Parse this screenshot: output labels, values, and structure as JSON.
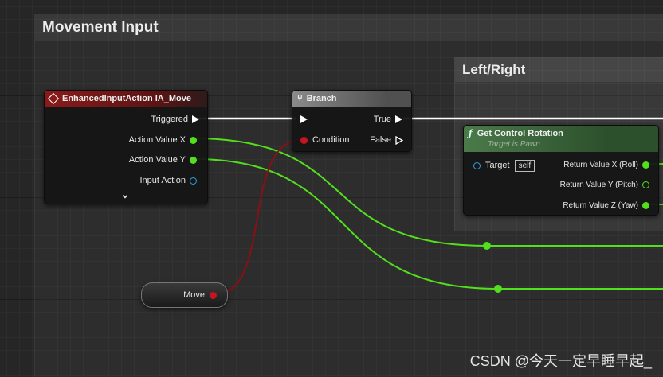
{
  "comments": {
    "movement_input": "Movement Input",
    "left_right": "Left/Right"
  },
  "nodes": {
    "enhanced_input": {
      "title": "EnhancedInputAction IA_Move",
      "pins": {
        "triggered": "Triggered",
        "action_value_x": "Action Value X",
        "action_value_y": "Action Value Y",
        "input_action": "Input Action"
      },
      "expand": "⌄"
    },
    "branch": {
      "title": "Branch",
      "pins": {
        "condition": "Condition",
        "true_label": "True",
        "false_label": "False"
      }
    },
    "get_control_rotation": {
      "title": "Get Control Rotation",
      "subtitle": "Target is Pawn",
      "target_label": "Target",
      "target_value": "self",
      "pins": {
        "roll": "Return Value X (Roll)",
        "pitch": "Return Value Y (Pitch)",
        "yaw": "Return Value Z (Yaw)"
      }
    },
    "move_var": {
      "label": "Move"
    }
  },
  "watermark": "CSDN @今天一定早睡早起_",
  "colors": {
    "exec": "#ffffff",
    "float": "#52e01c",
    "bool": "#c8141e",
    "object": "#2d9fe0"
  }
}
